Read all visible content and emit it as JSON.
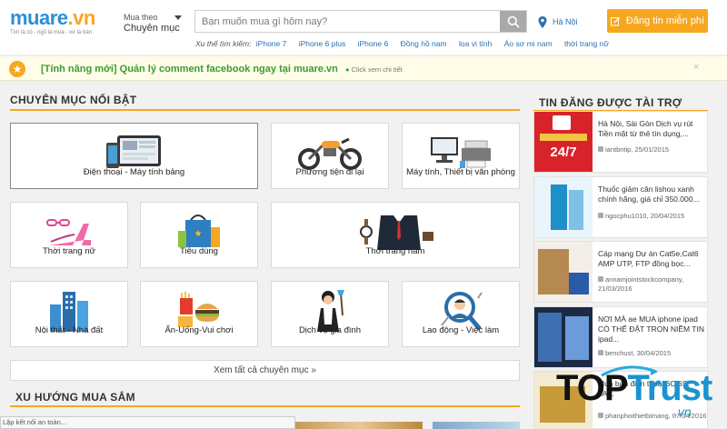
{
  "header": {
    "logo_text_main": "muare",
    "logo_text_dot": ".vn",
    "logo_tagline": "Tìm là có - ngõ là mua - xứ là bán",
    "category_toggle_line1": "Mua theo",
    "category_toggle_line2": "Chuyên mục",
    "search_placeholder": "Bạn muốn mua gì hôm nay?",
    "location": "Hà Nội",
    "post_button": "Đăng tin miễn phí",
    "trends_label": "Xu thế tìm kiếm:",
    "trends": [
      "iPhone 7",
      "iPhone 6 plus",
      "iPhone 6",
      "Đồng hồ nam",
      "loa vi tính",
      "Áo sơ mi nam",
      "thời trang nữ"
    ]
  },
  "announcement": {
    "message": "[Tính năng mới] Quản lý comment facebook ngay tại muare.vn",
    "detail": "Click xem chi tiết",
    "close": "×"
  },
  "featured": {
    "title": "CHUYÊN MỤC NỔI BẬT",
    "categories": [
      {
        "label": "Điện thoại - Máy tính bảng",
        "icon": "phone-tablet-icon"
      },
      {
        "label": "Phương tiện đi lại",
        "icon": "motorbike-icon"
      },
      {
        "label": "Máy tính, Thiết bị văn phòng",
        "icon": "computer-printer-icon"
      },
      {
        "label": "Thời trang nữ",
        "icon": "heels-glasses-icon"
      },
      {
        "label": "Tiêu dùng",
        "icon": "shopping-bag-icon"
      },
      {
        "label": "Thời trang nam",
        "icon": "suit-watch-icon"
      },
      {
        "label": "Nội thất - Nhà đất",
        "icon": "buildings-icon"
      },
      {
        "label": "Ẩn-Uống-Vui chơi",
        "icon": "fastfood-icon"
      },
      {
        "label": "Dịch vụ gia đình",
        "icon": "maid-icon"
      },
      {
        "label": "Lao động - Việc làm",
        "icon": "worker-icon"
      }
    ],
    "see_all": "Xem tất cả chuyên mục »"
  },
  "trending": {
    "title": "XU HƯỚNG MUA SẮM"
  },
  "sponsored": {
    "title": "TIN ĐĂNG ĐƯỢC TÀI TRỢ",
    "items": [
      {
        "text": "Hà Nội, Sài Gòn Dịch vụ rút Tiền mặt từ thẻ tín dụng,...",
        "user": "iantbntip, 25/01/2015",
        "thumb_text": "24/7"
      },
      {
        "text": "Thuốc giảm cân lishou xanh chính hãng, giá chỉ 350.000...",
        "user": "ngocphu1010, 20/04/2015",
        "thumb_text": ""
      },
      {
        "text": "Cáp mạng Dự án Cat5e,Cat6 AMP UTP, FTP đồng bọc...",
        "user": "annamjointstockcompany, 21/03/2016",
        "thumb_text": ""
      },
      {
        "text": "NƠI MÀ ae MUA iphone ipad CÓ THỂ ĐẶT TRỌN NIỀM TIN ipad...",
        "user": "benchust, 30/04/2015",
        "thumb_text": ""
      },
      {
        "text": "Mua bán điện thoại 6C 6S, 6A...",
        "user": "phanphoithietbimang, 07/04/2016",
        "thumb_text": ""
      }
    ]
  },
  "watermark": {
    "brand_a": "TOP",
    "brand_b": "Trust",
    "brand_c": ".vn"
  },
  "status_bar": "Lập kết nối an toàn...",
  "colors": {
    "accent_orange": "#f7a71f",
    "link_blue": "#2a6fb5",
    "logo_blue": "#2b8fd7",
    "announce_green": "#3a9c34"
  }
}
